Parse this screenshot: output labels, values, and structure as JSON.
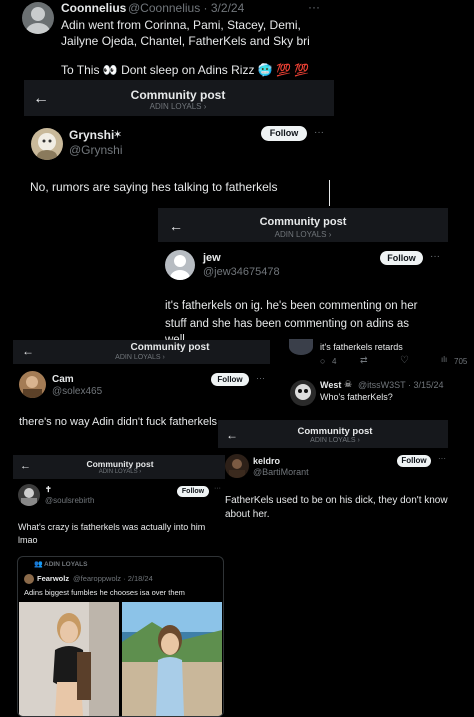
{
  "colors": {
    "bg": "#000000",
    "text": "#e7e9ea",
    "muted": "#71767b",
    "follow_bg": "#eff3f4",
    "panel": "#16181c"
  },
  "top_tweet": {
    "name": "Coonnelius",
    "handle_date": "@Coonnelius · 3/2/24",
    "line1": "Adin went from Corinna, Pami, Stacey, Demi,",
    "line2": "Jailyne Ojeda, Chantel, FatherKels and Sky bri",
    "line3": "To This 👀 Dont sleep on Adins Rizz 🥶 💯 💯",
    "more": "···"
  },
  "panel1": {
    "title": "Community post",
    "sub": "ADIN LOYALS ›",
    "name": "Grynshi",
    "handle": "@Grynshi",
    "follow": "Follow",
    "text": "No, rumors are saying hes talking to fatherkels"
  },
  "panel2": {
    "title": "Community post",
    "sub": "ADIN LOYALS ›",
    "name": "jew",
    "handle": "@jew34675478",
    "follow": "Follow",
    "line1": "it's fatherkels on ig. he's been commenting on her",
    "line2": "stuff and she has been commenting on adins as",
    "line3": "well",
    "reply_text": "it's fatherkels retards",
    "stats": {
      "replies": "4",
      "views": "705"
    }
  },
  "panel3": {
    "title": "Community post",
    "sub": "ADIN LOYALS ›",
    "name": "Cam",
    "handle": "@solex465",
    "follow": "Follow",
    "text": "there's no way Adin didn't fuck fatherkels"
  },
  "west": {
    "name": "West",
    "handle_date": "@itssW3ST · 3/15/24",
    "text": "Who's fatherKels?"
  },
  "panel4": {
    "title": "Community post",
    "sub": "ADIN LOYALS ›",
    "name": "keldro",
    "handle": "@BartiMorant",
    "follow": "Follow",
    "line1": "FatherKels used to be on his dick, they don't know",
    "line2": "about her."
  },
  "panel5": {
    "title": "Community post",
    "sub": "ADIN LOYALS ›",
    "name": "✝",
    "handle": "@soulsrebirth",
    "follow": "Follow",
    "line1": "What's crazy is fatherkels was actually into him",
    "line2": "lmao",
    "quote": {
      "community": "ADIN LOYALS",
      "name": "Fearwolz",
      "handle_date": "@fearoppwolz · 2/18/24",
      "text": "Adins biggest fumbles he chooses isa over them"
    }
  }
}
